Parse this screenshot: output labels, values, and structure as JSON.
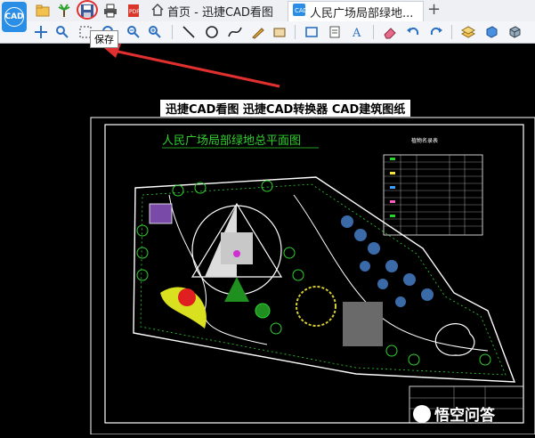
{
  "app": {
    "logo_text": "CAD"
  },
  "tabs": [
    {
      "label": "首页 - 迅捷CAD看图",
      "active": false
    },
    {
      "label": "人民广场局部绿地...",
      "active": true
    }
  ],
  "tooltip": {
    "text": "保存"
  },
  "drawing": {
    "heading": "迅捷CAD看图  迅捷CAD转换器   CAD建筑图纸",
    "plan_title": "人民广场局部绿地总平面图",
    "legend_title": "植物名录表"
  },
  "watermark": {
    "text": "悟空问答"
  },
  "colors": {
    "accent": "#2a8ee6",
    "highlight": "#e23030",
    "plan_title": "#2fd02f"
  },
  "icons": {
    "quick_access": [
      "open-icon",
      "plant-icon",
      "save-icon",
      "print-icon",
      "pdf-icon"
    ],
    "toolbar": [
      "pan-icon",
      "zoom-window-icon",
      "select-icon",
      "zoom-realtime-icon",
      "zoom-in-icon",
      "zoom-out-icon",
      "line-icon",
      "circle-icon",
      "spline-icon",
      "pen-icon",
      "text-edit-icon",
      "rect-icon",
      "layer-icon",
      "text-icon",
      "eraser-icon",
      "undo-icon",
      "redo-icon",
      "layers-icon",
      "cube-icon",
      "view3d-icon"
    ]
  }
}
